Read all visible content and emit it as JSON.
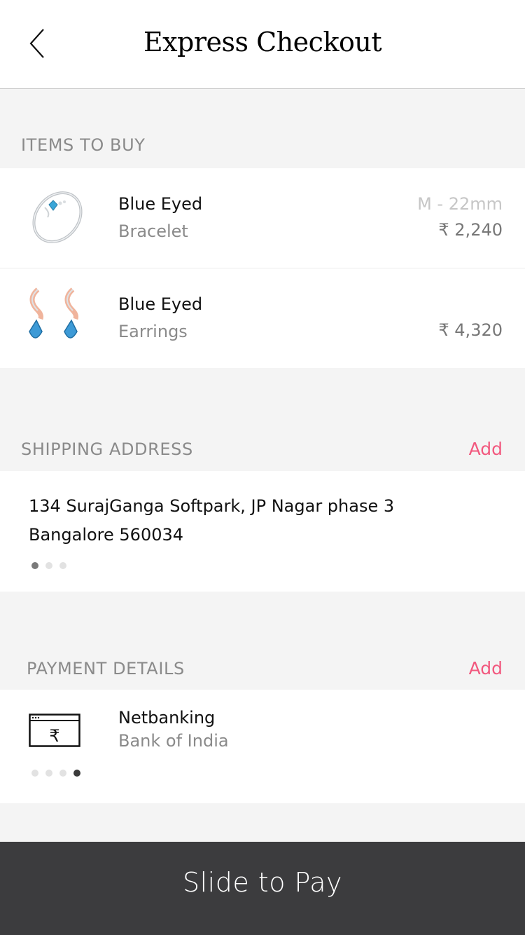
{
  "header": {
    "title": "Express Checkout",
    "back_icon": "chevron-left-icon"
  },
  "items_section": {
    "label": "ITEMS TO BUY",
    "items": [
      {
        "name": "Blue Eyed",
        "type": "Bracelet",
        "size": "M - 22mm",
        "price": "₹ 2,240"
      },
      {
        "name": "Blue Eyed",
        "type": "Earrings",
        "size": "",
        "price": "₹ 4,320"
      }
    ]
  },
  "shipping": {
    "label": "SHIPPING ADDRESS",
    "add_label": "Add",
    "address_line1": "134 SurajGanga Softpark, JP Nagar phase 3",
    "address_line2": "Bangalore 560034",
    "pager": {
      "count": 3,
      "active": 1
    }
  },
  "payment": {
    "label": "PAYMENT DETAILS",
    "add_label": "Add",
    "method": "Netbanking",
    "bank": "Bank of India",
    "icon": "netbanking-rupee-icon",
    "pager": {
      "count": 4,
      "active": 4
    }
  },
  "footer": {
    "slide_label": "Slide to Pay"
  },
  "colors": {
    "accent": "#f2587e",
    "footer_bg": "#3c3c3e",
    "page_bg": "#f4f4f4"
  }
}
